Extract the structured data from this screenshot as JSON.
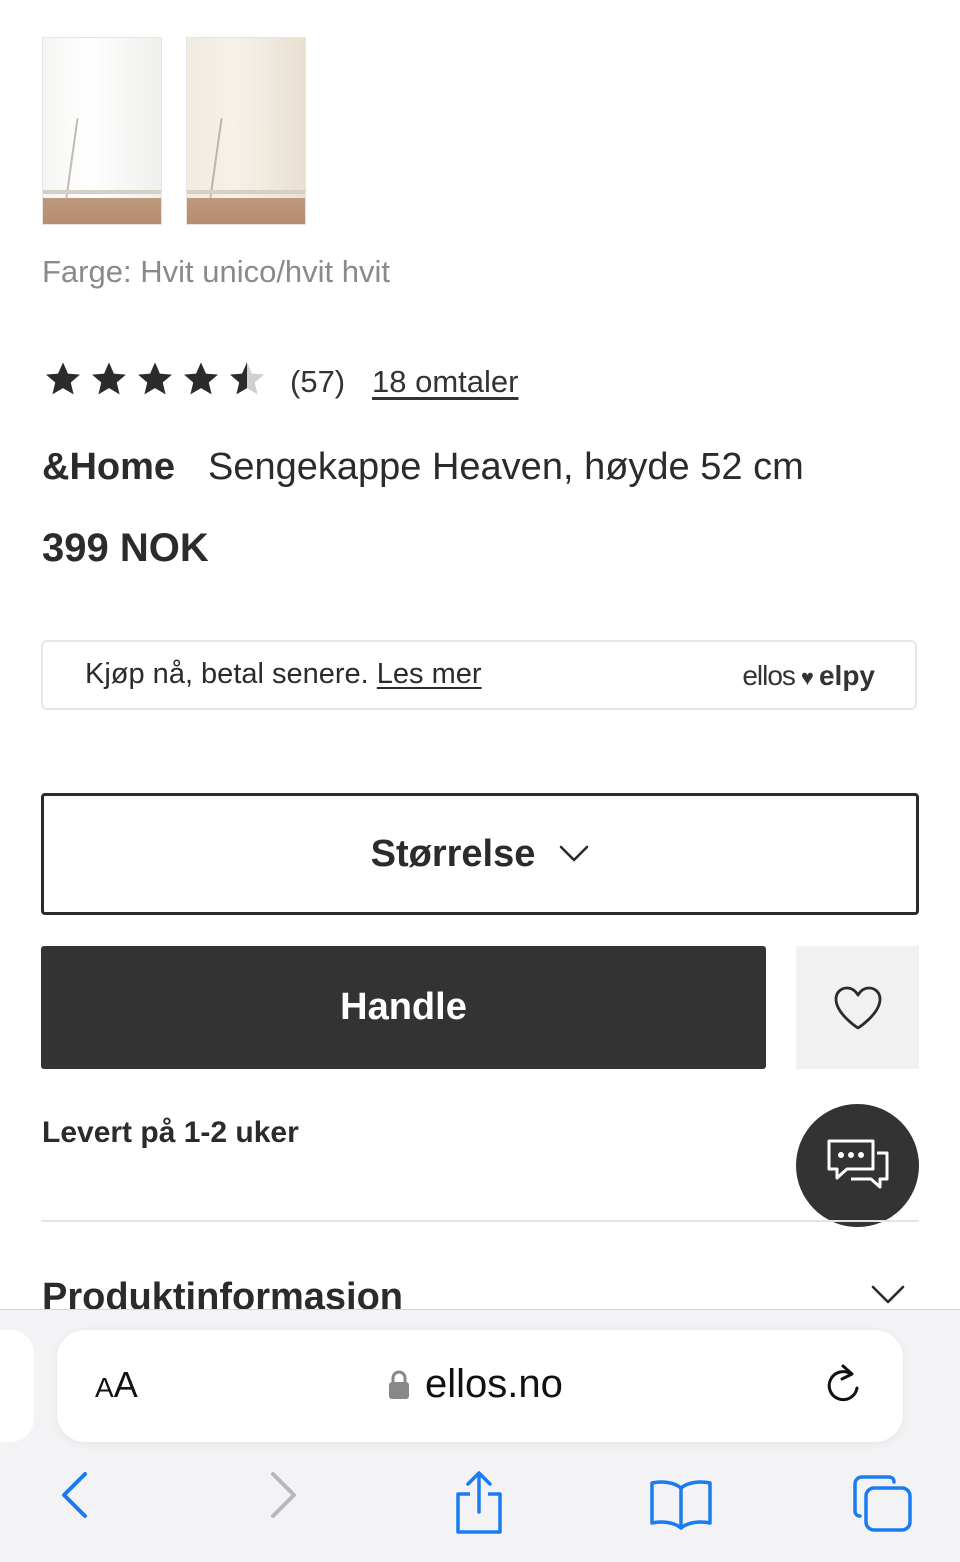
{
  "product": {
    "thumbnails": [
      {
        "alt": "Hvit"
      },
      {
        "alt": "Hvit unico"
      }
    ],
    "color_label": "Farge: Hvit unico/hvit hvit",
    "rating": {
      "stars": 4.5,
      "count_text": "(57)",
      "reviews_link": "18 omtaler"
    },
    "brand": "&Home",
    "name": "Sengekappe Heaven, høyde 52 cm",
    "price": "399 NOK"
  },
  "bnpl": {
    "text": "Kjøp nå, betal senere.",
    "link": "Les mer",
    "logo_left": "ellos",
    "logo_heart": "♥",
    "logo_right": "elpy"
  },
  "size_select": {
    "label": "Størrelse"
  },
  "buy_button": {
    "label": "Handle"
  },
  "delivery": "Levert på 1-2 uker",
  "accordion": {
    "title": "Produktinformasjon"
  },
  "browser": {
    "aa_small": "A",
    "aa_large": "A",
    "url": "ellos.no",
    "toolbar": [
      "back-icon",
      "forward-icon",
      "share-icon",
      "bookmarks-icon",
      "tabs-icon"
    ]
  },
  "colors": {
    "text": "#2b2b2b",
    "muted": "#8a8a8a",
    "button_dark": "#333333",
    "wish_bg": "#f1f1f1",
    "ios_blue": "#1a7cf0"
  }
}
